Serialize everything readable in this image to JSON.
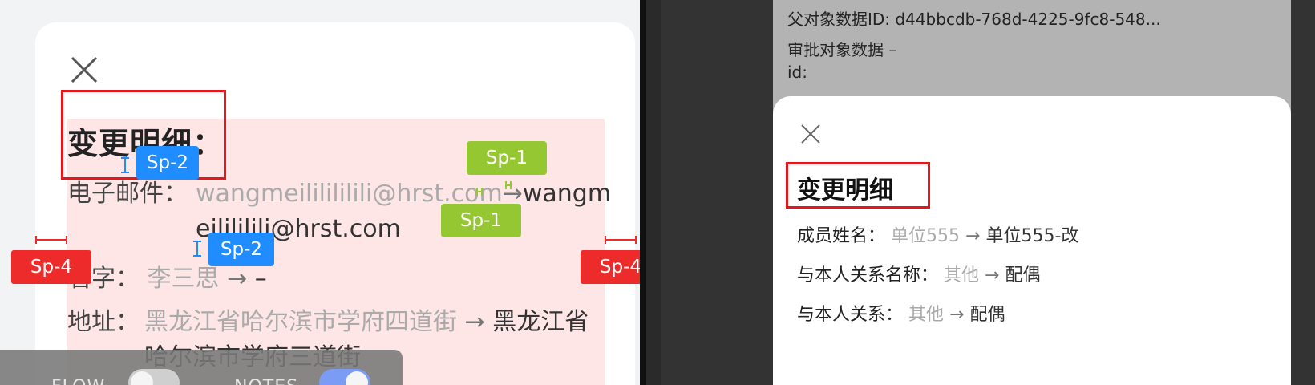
{
  "left": {
    "title": "变更明细：",
    "email": {
      "label": "电子邮件：",
      "old": "wangmeililililili@hrst.com",
      "arrow": "→",
      "new_part1": "wangm",
      "new_part2": "eilililili@hrst.com"
    },
    "name": {
      "label": "名字：",
      "old": "李三思",
      "arrow": "→",
      "new": "–"
    },
    "address": {
      "label": "地址：",
      "old": "黑龙江省哈尔滨市学府四道街",
      "arrow": "→",
      "new": "黑龙江省哈尔滨市学府三道街"
    },
    "spacing_tags": {
      "sp2_a": "Sp-2",
      "sp2_b": "Sp-2",
      "sp1_a": "Sp-1",
      "sp1_b": "Sp-1",
      "sp4_a": "Sp-4",
      "sp4_b": "Sp-4"
    },
    "toolbar": {
      "flow_label": "FLOW",
      "notes_label": "NOTES",
      "flow_on": false,
      "notes_on": true
    }
  },
  "right": {
    "meta": {
      "parent_id_label": "父对象数据ID:",
      "parent_id_value": "d44bbcdb-768d-4225-9fc8-548...",
      "approval_label": "审批对象数据",
      "approval_value": "–",
      "id_label": "id:"
    },
    "title": "变更明细",
    "rows": [
      {
        "label": "成员姓名：",
        "old": "单位555",
        "arrow": "→",
        "new": "单位555-改"
      },
      {
        "label": "与本人关系名称：",
        "old": "其他",
        "arrow": "→",
        "new": "配偶"
      },
      {
        "label": "与本人关系：",
        "old": "其他",
        "arrow": "→",
        "new": "配偶"
      }
    ]
  },
  "colors": {
    "highlight_red": "#e4171c",
    "tag_blue": "#1f8dff",
    "tag_green": "#95c732",
    "tag_red": "#ee2b2b",
    "toggle_on": "#7b9cf5"
  },
  "icons": [
    "close-icon"
  ]
}
